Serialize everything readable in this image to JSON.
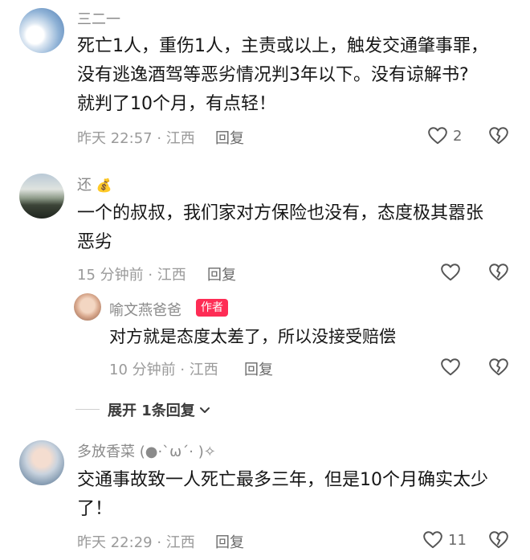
{
  "comments": [
    {
      "username": "三二一",
      "lines": [
        "死亡1人，重伤1人，主责或以上，触发交通肇事罪，",
        "没有逃逸酒驾等恶劣情况判3年以下。没有谅解书?",
        "就判了10个月，有点轻！"
      ],
      "meta": "昨天 22:57 · 江西",
      "reply_label": "回复",
      "likes": "2"
    },
    {
      "username": "还",
      "username_emoji": "💰",
      "lines": [
        "一个的叔叔，我们家对方保险也没有，态度极其嚣张",
        "恶劣"
      ],
      "meta": "15 分钟前 · 江西",
      "reply_label": "回复",
      "likes": ""
    }
  ],
  "reply": {
    "username": "喻文燕爸爸",
    "badge": "作者",
    "text": "对方就是态度太差了，所以没接受赔偿",
    "meta": "10 分钟前 · 江西",
    "reply_label": "回复"
  },
  "expand_label": "展开 1条回复",
  "comment3": {
    "username": "多放香菜 (●·`ω´· )✧",
    "lines": [
      "交通事故致一人死亡最多三年，但是10个月确实太少",
      "了！"
    ],
    "meta": "昨天 22:29 · 江西",
    "reply_label": "回复",
    "likes": "11"
  },
  "colors": {
    "badge": "#fe2c55",
    "text": "#161616",
    "meta": "#9a9a9a"
  },
  "icons": [
    "heart-icon",
    "broken-heart-icon",
    "chevron-down-icon"
  ]
}
